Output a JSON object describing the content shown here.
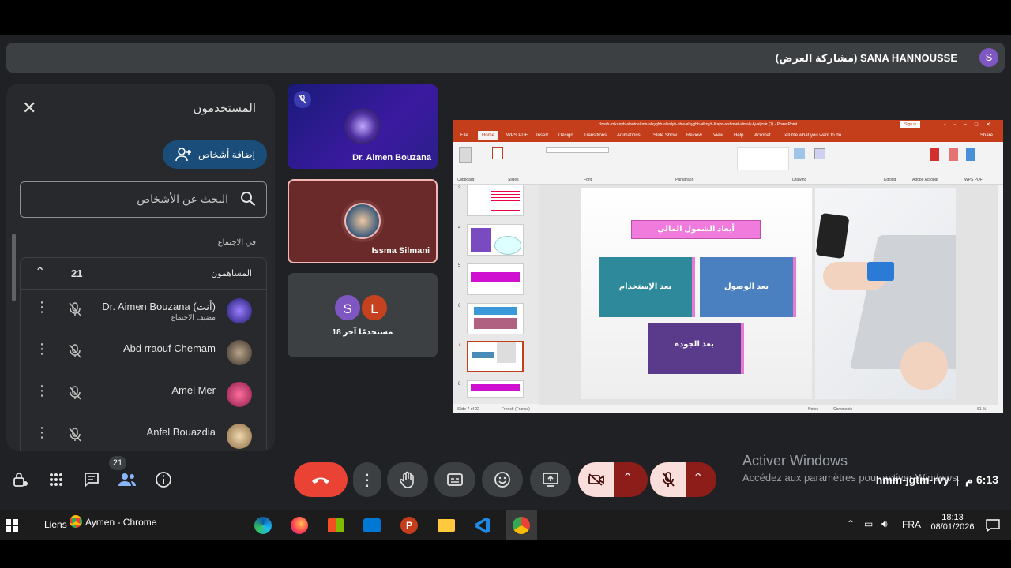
{
  "header": {
    "presenter_text": "SANA HANNOUSSE (مشاركة العرض)",
    "presenter_avatar": "S"
  },
  "people_panel": {
    "title": "المستخدمون",
    "add_button": "إضافة أشخاص",
    "search_placeholder": "البحث عن الأشخاص",
    "section_label": "في الاجتماع",
    "contributors_label": "المساهمون",
    "contributors_count": "21",
    "people": [
      {
        "name": "Dr. Aimen Bouzana (أنت)",
        "sub": "مضيف الاجتماع",
        "color": "#2a2a7a"
      },
      {
        "name": "Abd rraouf Chemam",
        "sub": "",
        "color": "#6b5a4a"
      },
      {
        "name": "Amel Mer",
        "sub": "",
        "color": "#c2185b"
      },
      {
        "name": "Anfel Bouazdia",
        "sub": "",
        "color": "#d7b98a"
      }
    ]
  },
  "tiles": {
    "tile1_name": "Dr. Aimen Bouzana",
    "tile2_name": "Issma Silmani",
    "tile3_avatar1": "S",
    "tile3_avatar2": "L",
    "tile3_label": "18 مستخدمًا آخر"
  },
  "powerpoint": {
    "title": "dzesh-imkanyh-alantqal-mn-alsyghh-alkrdyh-nhw-alsyghh-alkrtyh-litayo-alshmwl-almaly-fy-aljzair (1) - PowerPoint",
    "sign_in": "Sign in",
    "tabs": [
      "File",
      "Home",
      "WPS PDF",
      "Insert",
      "Design",
      "Transitions",
      "Animations",
      "Slide Show",
      "Review",
      "View",
      "Help",
      "Acrobat",
      "Tell me what you want to do",
      "Share"
    ],
    "groups": [
      "Clipboard",
      "Slides",
      "Font",
      "Paragraph",
      "Drawing",
      "Editing",
      "Adobe Acrobat",
      "WPS PDF"
    ],
    "slide_numbers": [
      "3",
      "4",
      "5",
      "6",
      "7",
      "8"
    ],
    "slide_title": "أبعاد الشمول المالي",
    "box1": "بعد الإستخدام",
    "box2": "بعد الوصول",
    "box3": "بعد الجودة",
    "status_slide": "Slide 7 of 22",
    "status_lang": "French (France)",
    "status_notes": "Notes",
    "status_comments": "Comments",
    "zoom": "61 %"
  },
  "bottom": {
    "chat_badge": "21",
    "watermark_title": "Activer Windows",
    "watermark_sub": "Accédez aux paramètres pour activer Windows.",
    "meeting_code": "hmm-jgtm-rvy",
    "time": "6:13 م"
  },
  "taskbar": {
    "liens": "Liens",
    "chrome_label": "Aymen - Chrome",
    "lang": "FRA",
    "clock_time": "18:13",
    "clock_date": "08/01/2026"
  }
}
